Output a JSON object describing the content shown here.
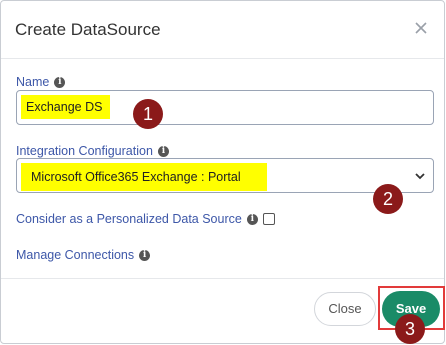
{
  "dialog": {
    "title": "Create DataSource"
  },
  "form": {
    "name_label": "Name",
    "name_value": "Exchange DS",
    "integration_label": "Integration Configuration",
    "integration_value": "Microsoft Office365 Exchange : Portal",
    "personalized_label": "Consider as a Personalized Data Source",
    "manage_connections_label": "Manage Connections"
  },
  "buttons": {
    "close_label": "Close",
    "save_label": "Save"
  },
  "annotations": {
    "step1": "1",
    "step2": "2",
    "step3": "3"
  },
  "colors": {
    "label_blue": "#3d57a8",
    "highlight_yellow": "#ffff00",
    "save_green": "#1a8b67",
    "badge_maroon": "#8b1a1a",
    "frame_red": "#e23a3a"
  },
  "icons": {
    "close": "close-icon",
    "info": "info-icon",
    "dropdown": "chevron-down-icon"
  }
}
